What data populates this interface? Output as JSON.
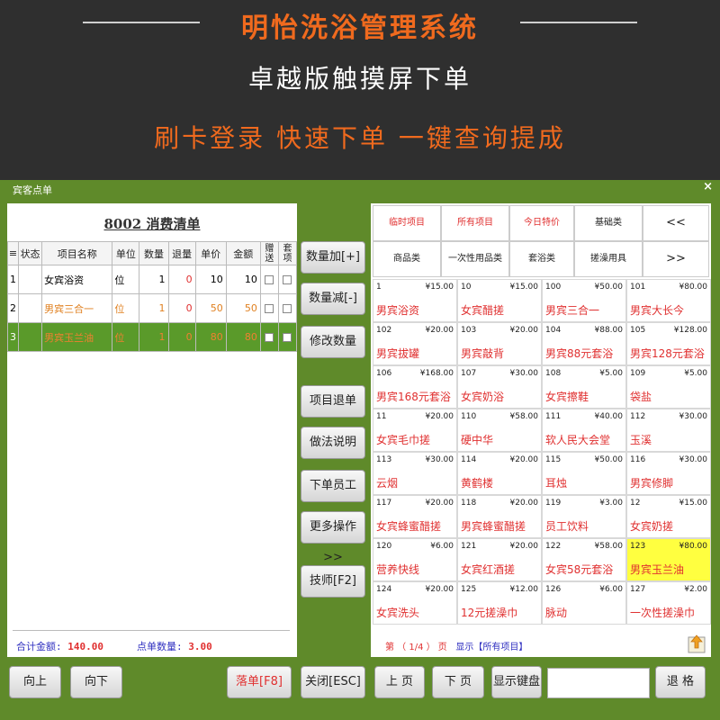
{
  "banner": {
    "title": "明怡洗浴管理系统",
    "subtitle": "卓越版触摸屏下单",
    "slogan": "刷卡登录 快速下单 一键查询提成"
  },
  "window": {
    "title": "宾客点单",
    "close_label": "×"
  },
  "order": {
    "title": "8002 消费清单",
    "headers": [
      "≡",
      "状态",
      "项目名称",
      "单位",
      "数量",
      "退量",
      "单价",
      "金额",
      "赠送",
      "套项"
    ],
    "rows": [
      {
        "idx": "1",
        "status": "",
        "name": "女宾浴资",
        "unit": "位",
        "qty": "1",
        "ret": "0",
        "price": "10",
        "amount": "10"
      },
      {
        "idx": "2",
        "status": "",
        "name": "男宾三合一",
        "unit": "位",
        "qty": "1",
        "ret": "0",
        "price": "50",
        "amount": "50"
      },
      {
        "idx": "3",
        "status": "",
        "name": "男宾玉兰油",
        "unit": "位",
        "qty": "1",
        "ret": "0",
        "price": "80",
        "amount": "80"
      }
    ],
    "total_label": "合计金额:",
    "total_value": "140.00",
    "count_label": "点单数量:",
    "count_value": "3.00"
  },
  "mid_buttons": [
    "数量加[+]",
    "数量减[-]",
    "修改数量",
    "项目退单",
    "做法说明",
    "下单员工",
    "更多操作>>",
    "技师[F2]"
  ],
  "categories": [
    {
      "label": "临时项目",
      "red": true
    },
    {
      "label": "所有项目",
      "red": true
    },
    {
      "label": "今日特价",
      "red": true
    },
    {
      "label": "基础类",
      "red": false
    },
    {
      "label": "<<",
      "red": false
    },
    {
      "label": "商品类",
      "red": false
    },
    {
      "label": "一次性用品类",
      "red": false
    },
    {
      "label": "套浴类",
      "red": false
    },
    {
      "label": "搓澡用具",
      "red": false
    },
    {
      "label": ">>",
      "red": false
    }
  ],
  "items": [
    {
      "code": "1",
      "price": "¥15.00",
      "name": "男宾浴资"
    },
    {
      "code": "10",
      "price": "¥15.00",
      "name": "女宾醋搓"
    },
    {
      "code": "100",
      "price": "¥50.00",
      "name": "男宾三合一"
    },
    {
      "code": "101",
      "price": "¥80.00",
      "name": "男宾大长今"
    },
    {
      "code": "102",
      "price": "¥20.00",
      "name": "男宾拔罐"
    },
    {
      "code": "103",
      "price": "¥20.00",
      "name": "男宾敲背"
    },
    {
      "code": "104",
      "price": "¥88.00",
      "name": "男宾88元套浴"
    },
    {
      "code": "105",
      "price": "¥128.00",
      "name": "男宾128元套浴"
    },
    {
      "code": "106",
      "price": "¥168.00",
      "name": "男宾168元套浴"
    },
    {
      "code": "107",
      "price": "¥30.00",
      "name": "女宾奶浴"
    },
    {
      "code": "108",
      "price": "¥5.00",
      "name": "女宾擦鞋"
    },
    {
      "code": "109",
      "price": "¥5.00",
      "name": "袋盐"
    },
    {
      "code": "11",
      "price": "¥20.00",
      "name": "女宾毛巾搓"
    },
    {
      "code": "110",
      "price": "¥58.00",
      "name": "硬中华"
    },
    {
      "code": "111",
      "price": "¥40.00",
      "name": "软人民大会堂"
    },
    {
      "code": "112",
      "price": "¥30.00",
      "name": "玉溪"
    },
    {
      "code": "113",
      "price": "¥30.00",
      "name": "云烟"
    },
    {
      "code": "114",
      "price": "¥20.00",
      "name": "黄鹤楼"
    },
    {
      "code": "115",
      "price": "¥50.00",
      "name": "耳烛"
    },
    {
      "code": "116",
      "price": "¥30.00",
      "name": "男宾修脚"
    },
    {
      "code": "117",
      "price": "¥20.00",
      "name": "女宾蜂蜜醋搓"
    },
    {
      "code": "118",
      "price": "¥20.00",
      "name": "男宾蜂蜜醋搓"
    },
    {
      "code": "119",
      "price": "¥3.00",
      "name": "员工饮料"
    },
    {
      "code": "12",
      "price": "¥15.00",
      "name": "女宾奶搓"
    },
    {
      "code": "120",
      "price": "¥6.00",
      "name": "营养快线"
    },
    {
      "code": "121",
      "price": "¥20.00",
      "name": "女宾红酒搓"
    },
    {
      "code": "122",
      "price": "¥58.00",
      "name": "女宾58元套浴"
    },
    {
      "code": "123",
      "price": "¥80.00",
      "name": "男宾玉兰油"
    },
    {
      "code": "124",
      "price": "¥20.00",
      "name": "女宾洗头"
    },
    {
      "code": "125",
      "price": "¥12.00",
      "name": "12元搓澡巾"
    },
    {
      "code": "126",
      "price": "¥6.00",
      "name": "脉动"
    },
    {
      "code": "127",
      "price": "¥2.00",
      "name": "一次性搓澡巾"
    }
  ],
  "pager": {
    "text": "第 （ 1/4 ） 页",
    "filter": "显示【所有项目】"
  },
  "bottom": {
    "up": "向上",
    "down": "向下",
    "submit": "落单[F8]",
    "close": "关闭[ESC]",
    "prev": "上 页",
    "next": "下 页",
    "keyboard": "显示键盘",
    "backspace": "退 格"
  },
  "colors": {
    "window_green": "#5f8a2a",
    "accent_orange": "#f06a1e",
    "item_red": "#e03030",
    "highlight_yellow": "#ffff40"
  }
}
